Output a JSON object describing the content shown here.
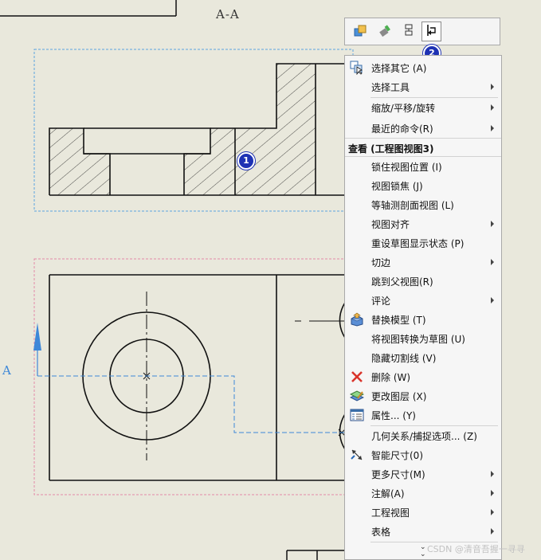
{
  "view_labels": {
    "section_title": "A-A",
    "arrow_label": "A"
  },
  "badges": {
    "one": "1",
    "two": "2"
  },
  "toolbar": {
    "buttons": [
      {
        "icon": "select-other-tool-icon"
      },
      {
        "icon": "rebuild-icon"
      },
      {
        "icon": "view-align-icon"
      },
      {
        "icon": "flip-view-direction-icon",
        "active": true
      }
    ]
  },
  "menu": {
    "header": "查看 (工程图视图3)",
    "items": [
      {
        "label": "选择其它 (A)",
        "icon": "select-other-icon",
        "submenu": false
      },
      {
        "label": "选择工具",
        "submenu": true
      },
      {
        "label": "缩放/平移/旋转",
        "submenu": true
      },
      {
        "label": "最近的命令(R)",
        "submenu": true
      },
      {
        "label": "锁住视图位置 (I)",
        "submenu": false
      },
      {
        "label": "视图锁焦 (J)",
        "submenu": false
      },
      {
        "label": "等轴测剖面视图 (L)",
        "submenu": false
      },
      {
        "label": "视图对齐",
        "submenu": true
      },
      {
        "label": "重设草图显示状态 (P)",
        "submenu": false
      },
      {
        "label": "切边",
        "submenu": true
      },
      {
        "label": "跳到父视图(R)",
        "submenu": false
      },
      {
        "label": "评论",
        "submenu": true
      },
      {
        "label": "替换模型 (T)",
        "icon": "replace-model-icon",
        "submenu": false
      },
      {
        "label": "将视图转换为草图 (U)",
        "submenu": false
      },
      {
        "label": "隐藏切割线 (V)",
        "submenu": false
      },
      {
        "label": "删除 (W)",
        "icon": "delete-icon",
        "submenu": false
      },
      {
        "label": "更改图层 (X)",
        "icon": "change-layer-icon",
        "submenu": false
      },
      {
        "label": "属性... (Y)",
        "icon": "properties-icon",
        "submenu": false
      },
      {
        "label": "几何关系/捕捉选项... (Z)",
        "submenu": false
      },
      {
        "label": "智能尺寸(0)",
        "icon": "smart-dimension-icon",
        "submenu": false
      },
      {
        "label": "更多尺寸(M)",
        "submenu": true
      },
      {
        "label": "注解(A)",
        "submenu": true
      },
      {
        "label": "工程视图",
        "submenu": true
      },
      {
        "label": "表格",
        "submenu": true
      }
    ]
  },
  "watermark": "CSDN @清音吾握一寻寻"
}
